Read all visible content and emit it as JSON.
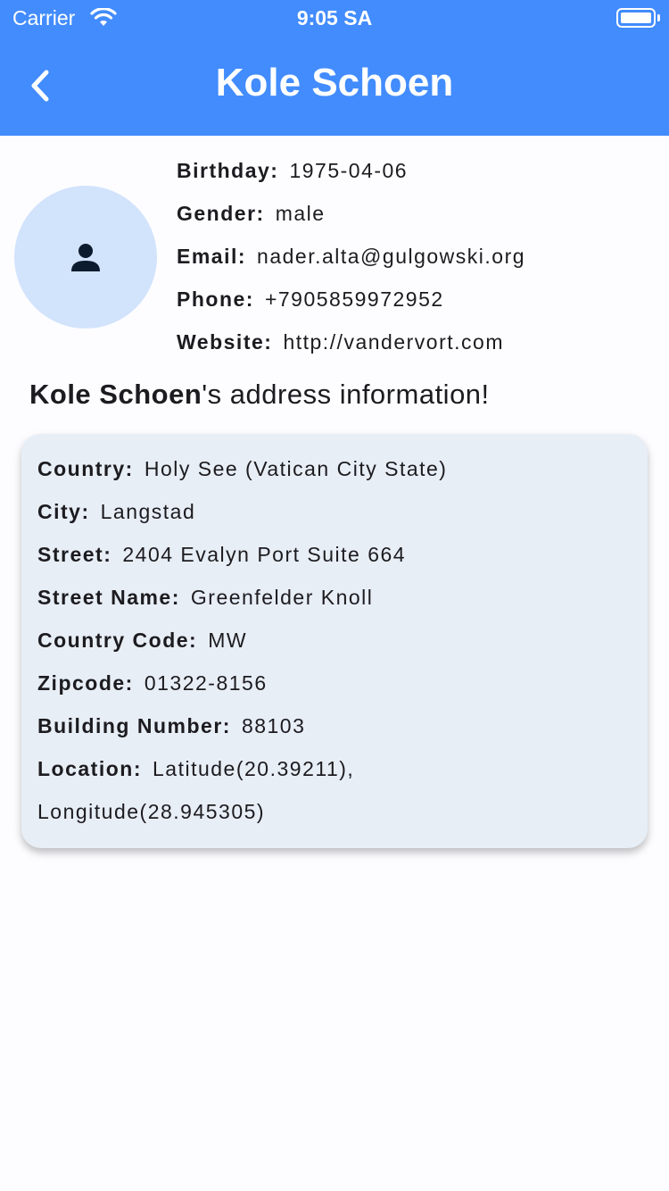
{
  "status_bar": {
    "carrier": "Carrier",
    "time": "9:05 SA",
    "battery_level": 1.0
  },
  "header": {
    "title": "Kole Schoen",
    "back_icon": "chevron-left-icon",
    "background_color": "#428cfd"
  },
  "profile": {
    "avatar_icon": "person-icon",
    "fields": [
      {
        "label": "Birthday:",
        "value": "1975-04-06"
      },
      {
        "label": "Gender:",
        "value": "male"
      },
      {
        "label": "Email:",
        "value": "nader.alta@gulgowski.org"
      },
      {
        "label": "Phone:",
        "value": "+7905859972952"
      },
      {
        "label": "Website:",
        "value": "http://vandervort.com"
      }
    ]
  },
  "address_heading": {
    "name": "Kole Schoen",
    "suffix": "'s address information!"
  },
  "address": {
    "fields": [
      {
        "label": "Country:",
        "value": "Holy See (Vatican City State)"
      },
      {
        "label": "City:",
        "value": "Langstad"
      },
      {
        "label": "Street:",
        "value": "2404 Evalyn Port Suite 664"
      },
      {
        "label": "Street Name:",
        "value": "Greenfelder Knoll"
      },
      {
        "label": "Country Code:",
        "value": "MW"
      },
      {
        "label": "Zipcode:",
        "value": "01322-8156"
      },
      {
        "label": "Building Number:",
        "value": "88103"
      },
      {
        "label": "Location:",
        "value": "Latitude(20.39211),"
      }
    ],
    "location_continued": "Longitude(28.945305)"
  }
}
